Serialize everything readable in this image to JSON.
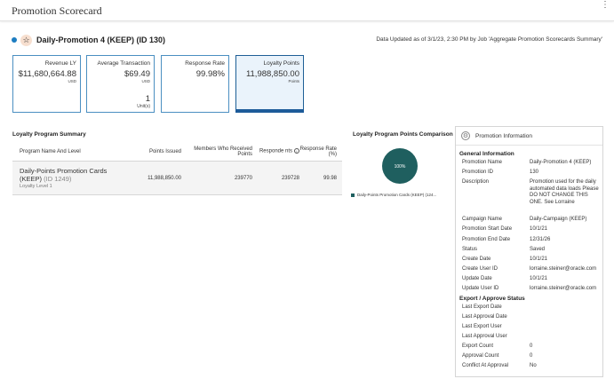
{
  "app": {
    "title": "Promotion Scorecard",
    "menu_glyph": "⋮"
  },
  "promotion": {
    "name": "Daily-Promotion 4 (KEEP) (ID 130)",
    "status_color": "#1d7dc1",
    "badge_icon": "star-icon",
    "updated_text": "Data Updated as of 3/1/23, 2:30 PM by Job 'Aggregate Promotion Scorecards Summary'"
  },
  "kpis": [
    {
      "label": "Revenue LY",
      "value": "$11,680,664.88",
      "unit": "USD"
    },
    {
      "label": "Average Transaction",
      "value": "$69.49",
      "unit": "USD",
      "extra_value": "1",
      "extra_unit": "Unit(s)"
    },
    {
      "label": "Response Rate",
      "value": "99.98%"
    },
    {
      "label": "Loyalty Points",
      "value": "11,988,850.00",
      "unit": "Points",
      "selected": true
    }
  ],
  "loyalty_summary": {
    "title": "Loyalty Program Summary",
    "columns": [
      "Program Name And Level",
      "Points Issued",
      "Members Who Received Points",
      "Responde nts",
      "Response Rate (%)"
    ],
    "rows": [
      {
        "name": "Daily-Points Promotion Cards (KEEP)",
        "id": "(ID 1249)",
        "level": "Loyalty Level 1",
        "points": "11,988,850.00",
        "members": "239770",
        "respondents": "239728",
        "rate": "99.98"
      }
    ]
  },
  "comparison": {
    "title": "Loyalty Program Points Comparison",
    "slice_label": "100%",
    "legend_label": "Daily-Points Promotion Cards (KEEP) (124...",
    "color": "#1f5f5f"
  },
  "chart_data": {
    "type": "pie",
    "title": "Loyalty Program Points Comparison",
    "series": [
      {
        "name": "Daily-Points Promotion Cards (KEEP) (124...",
        "values": [
          100
        ]
      }
    ],
    "data_labels": [
      "100%"
    ]
  },
  "info": {
    "title": "Promotion Information",
    "general_title": "General Information",
    "general": [
      {
        "k": "Promotion Name",
        "v": "Daily-Promotion 4 (KEEP)"
      },
      {
        "k": "Promotion ID",
        "v": "130"
      },
      {
        "k": "Description",
        "v": "Promotion used for the daily automated data loads Please DO NOT CHANGE THIS ONE. See Lorraine"
      },
      {
        "k": "Campaign Name",
        "v": "Daily-Campaign (KEEP)"
      },
      {
        "k": "Promotion Start Date",
        "v": "10/1/21"
      },
      {
        "k": "Promotion End Date",
        "v": "12/31/26"
      },
      {
        "k": "Status",
        "v": "Saved"
      },
      {
        "k": "Create Date",
        "v": "10/1/21"
      },
      {
        "k": "Create User ID",
        "v": "lorraine.steiner@oracle.com"
      },
      {
        "k": "Update Date",
        "v": "10/1/21"
      },
      {
        "k": "Update User ID",
        "v": "lorraine.steiner@oracle.com"
      }
    ],
    "export_title": "Export / Approve Status",
    "export": [
      {
        "k": "Last Export Date",
        "v": ""
      },
      {
        "k": "Last Approval Date",
        "v": ""
      },
      {
        "k": "Last Export User",
        "v": ""
      },
      {
        "k": "Last Approval User",
        "v": ""
      },
      {
        "k": "Export Count",
        "v": "0"
      },
      {
        "k": "Approval Count",
        "v": "0"
      },
      {
        "k": "Conflict At Approval",
        "v": "No"
      }
    ]
  }
}
